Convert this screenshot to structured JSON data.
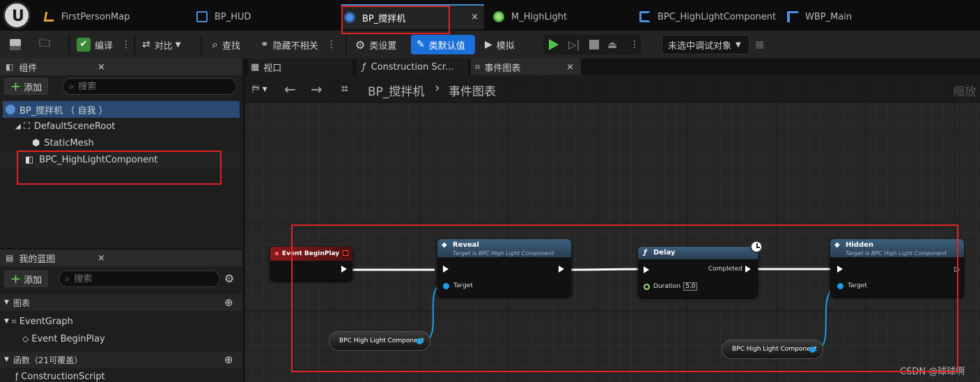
{
  "tabs": [
    {
      "label": "FirstPersonMap"
    },
    {
      "label": "BP_HUD"
    },
    {
      "label": "BP_搅拌机",
      "close": "×"
    },
    {
      "label": "M_HighLight"
    },
    {
      "label": "BPC_HighLightComponent"
    },
    {
      "label": "WBP_Main"
    }
  ],
  "toolbar": {
    "compile": "编译",
    "diff": "对比",
    "find": "查找",
    "hide_unrelated": "隐藏不相关",
    "class_settings": "类设置",
    "class_defaults": "类默认值",
    "simulate": "模拟",
    "debug_target": "未选中调试对象"
  },
  "components": {
    "title": "组件",
    "close": "×",
    "add": "添加",
    "search_placeholder": "搜索",
    "items": [
      {
        "label": "BP_搅拌机 （ 自我 ）"
      },
      {
        "label": "DefaultSceneRoot"
      },
      {
        "label": "StaticMesh"
      },
      {
        "label": "BPC_HighLightComponent"
      }
    ]
  },
  "my_blueprint": {
    "title": "我的蓝图",
    "close": "×",
    "add": "添加",
    "search_placeholder": "搜索",
    "graphs_label": "图表",
    "event_graph": "EventGraph",
    "event_begin_play": "Event BeginPlay",
    "functions_label": "函数（21可覆盖）",
    "construction_script": "ConstructionScript"
  },
  "graph_tabs": {
    "viewport": "视口",
    "construction": "Construction Scr...",
    "event_graph": "事件图表",
    "close": "×"
  },
  "breadcrumb": {
    "bp": "BP_搅拌机",
    "sep": "›",
    "graph": "事件图表",
    "zoom": "缩放"
  },
  "nodes": {
    "begin_play": "Event BeginPlay",
    "reveal": {
      "title": "Reveal",
      "subtitle": "Target is BPC High Light Component",
      "target": "Target"
    },
    "delay": {
      "title": "Delay",
      "completed": "Completed",
      "duration_label": "Duration",
      "duration_value": "5.0"
    },
    "hidden": {
      "title": "Hidden",
      "subtitle": "Target is BPC High Light Component",
      "target": "Target"
    },
    "get_component_1": "BPC High Light Component",
    "get_component_2": "BPC High Light Component"
  },
  "watermark": "CSDN @球球啊",
  "colors": {
    "accent": "#1a6fd8",
    "highlight_box": "#e52222",
    "function_header": "#3b5f7c",
    "event_header": "#8a1a1a",
    "object_pin": "#19a0e8"
  }
}
